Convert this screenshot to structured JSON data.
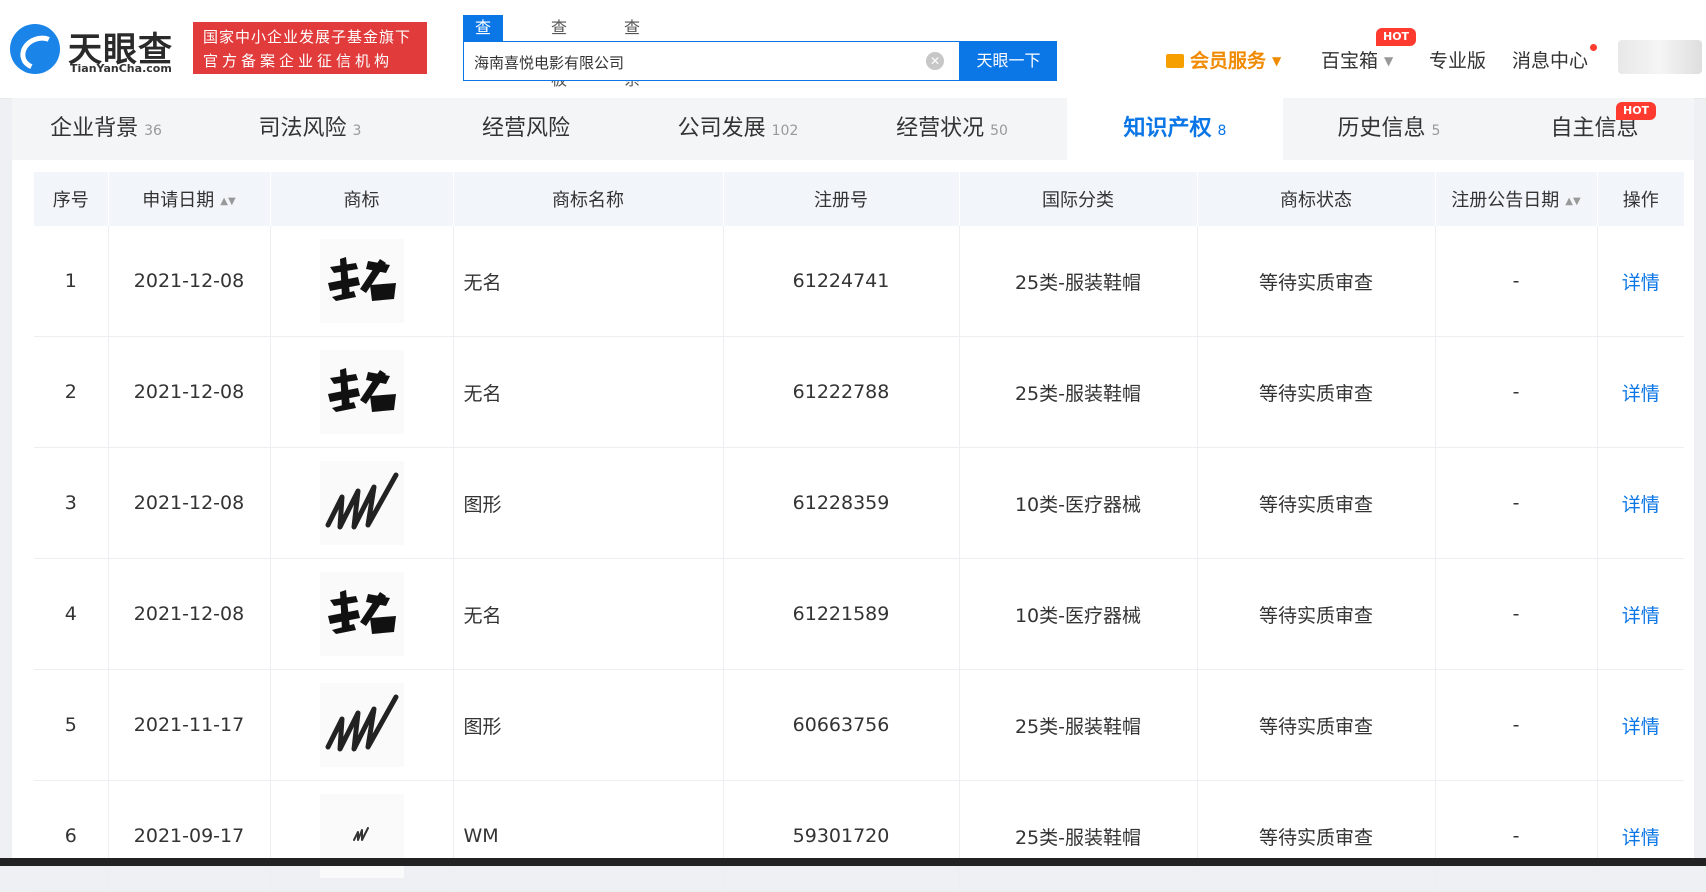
{
  "brand": {
    "name": "天眼查",
    "domain": "TianYanCha.com",
    "slogan_line1": "国家中小企业发展子基金旗下",
    "slogan_line2": "官方备案企业征信机构"
  },
  "search": {
    "tabs": [
      "查公司",
      "查老板",
      "查关系"
    ],
    "value": "海南喜悦电影有限公司",
    "button": "天眼一下"
  },
  "nav": {
    "member": "会员服务",
    "toolbox": "百宝箱",
    "toolbox_badge": "HOT",
    "pro": "专业版",
    "messages": "消息中心"
  },
  "tabs": [
    {
      "label": "企业背景",
      "count": "36"
    },
    {
      "label": "司法风险",
      "count": "3"
    },
    {
      "label": "经营风险",
      "count": ""
    },
    {
      "label": "公司发展",
      "count": "102"
    },
    {
      "label": "经营状况",
      "count": "50"
    },
    {
      "label": "知识产权",
      "count": "8"
    },
    {
      "label": "历史信息",
      "count": "5"
    },
    {
      "label": "自主信息",
      "count": "",
      "badge": "HOT"
    }
  ],
  "table": {
    "headers": [
      "序号",
      "申请日期",
      "商标",
      "商标名称",
      "注册号",
      "国际分类",
      "商标状态",
      "注册公告日期",
      "操作"
    ],
    "rows": [
      {
        "no": "1",
        "date": "2021-12-08",
        "logo": "wuming-calligraphy",
        "name": "无名",
        "reg": "61224741",
        "cls": "25类-服装鞋帽",
        "status": "等待实质审查",
        "pub": "-",
        "op": "详情"
      },
      {
        "no": "2",
        "date": "2021-12-08",
        "logo": "wuming-calligraphy",
        "name": "无名",
        "reg": "61222788",
        "cls": "25类-服装鞋帽",
        "status": "等待实质审查",
        "pub": "-",
        "op": "详情"
      },
      {
        "no": "3",
        "date": "2021-12-08",
        "logo": "scribble-mark",
        "name": "图形",
        "reg": "61228359",
        "cls": "10类-医疗器械",
        "status": "等待实质审查",
        "pub": "-",
        "op": "详情"
      },
      {
        "no": "4",
        "date": "2021-12-08",
        "logo": "wuming-calligraphy",
        "name": "无名",
        "reg": "61221589",
        "cls": "10类-医疗器械",
        "status": "等待实质审查",
        "pub": "-",
        "op": "详情"
      },
      {
        "no": "5",
        "date": "2021-11-17",
        "logo": "scribble-mark",
        "name": "图形",
        "reg": "60663756",
        "cls": "25类-服装鞋帽",
        "status": "等待实质审查",
        "pub": "-",
        "op": "详情"
      },
      {
        "no": "6",
        "date": "2021-09-17",
        "logo": "small-wm-mark",
        "name": "WM",
        "reg": "59301720",
        "cls": "25类-服装鞋帽",
        "status": "等待实质审查",
        "pub": "-",
        "op": "详情"
      }
    ]
  }
}
